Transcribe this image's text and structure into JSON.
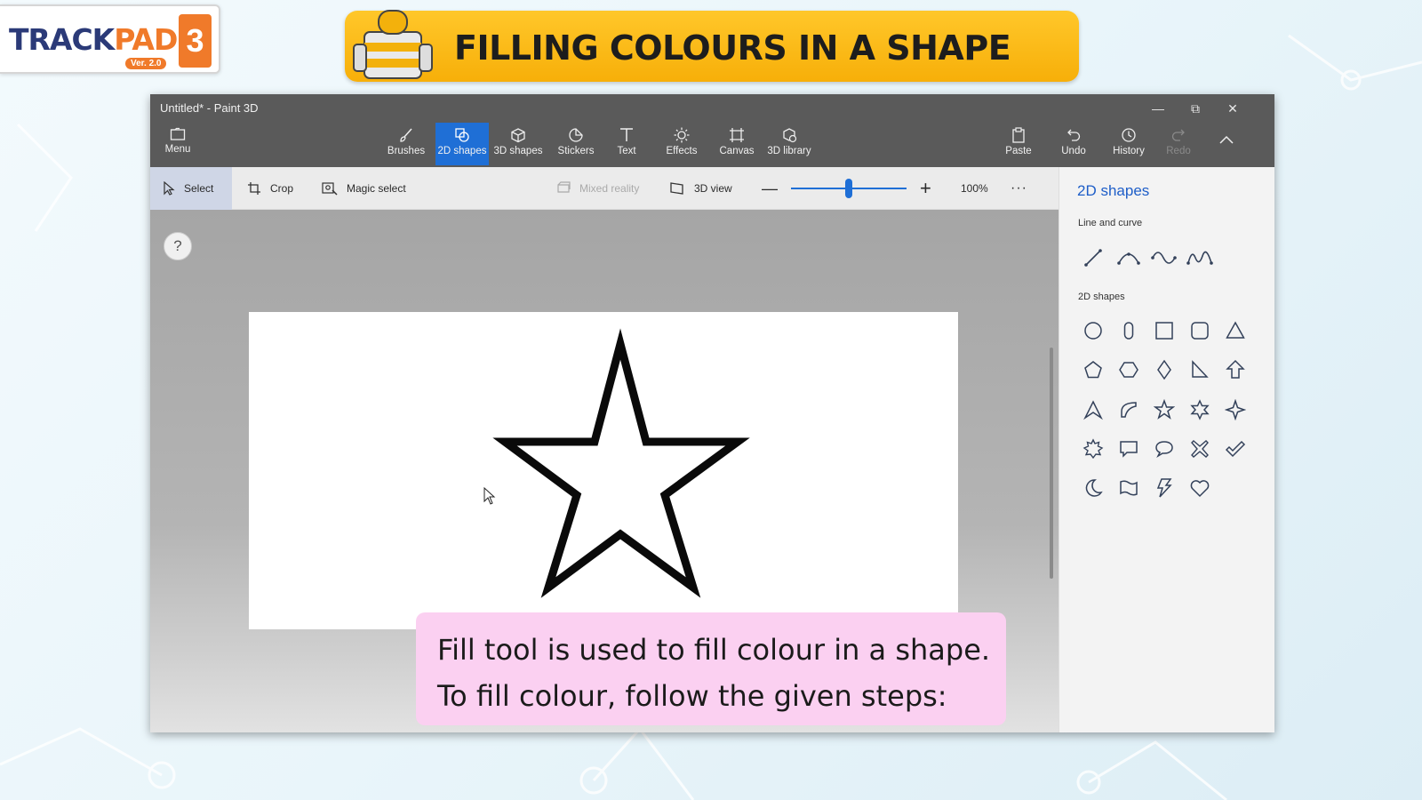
{
  "logo": {
    "word_a": "TRACK",
    "word_b": "PAD",
    "version": "Ver. 2.0",
    "number": "3"
  },
  "banner": {
    "title": "FILLING COLOURS IN A SHAPE"
  },
  "window": {
    "title": "Untitled* - Paint 3D"
  },
  "ribbon": {
    "menu": "Menu",
    "brushes": "Brushes",
    "shapes2d": "2D shapes",
    "shapes3d": "3D shapes",
    "stickers": "Stickers",
    "text": "Text",
    "effects": "Effects",
    "canvas": "Canvas",
    "library": "3D library",
    "paste": "Paste",
    "undo": "Undo",
    "history": "History",
    "redo": "Redo"
  },
  "toolbar": {
    "select": "Select",
    "crop": "Crop",
    "magic_select": "Magic select",
    "mixed_reality": "Mixed reality",
    "view3d": "3D view",
    "zoom": "100%",
    "zoom_level": 0.5
  },
  "panel": {
    "title": "2D shapes",
    "section_lines": "Line and curve",
    "section_shapes": "2D shapes"
  },
  "caption": {
    "line1": "Fill tool is used to fill colour in a shape.",
    "line2": "To fill colour, follow the given steps:"
  },
  "colors": {
    "accent": "#1f6fd6",
    "chrome": "#5a5a5a",
    "banner": "#ffc72a",
    "caption": "#fbd0f1"
  }
}
